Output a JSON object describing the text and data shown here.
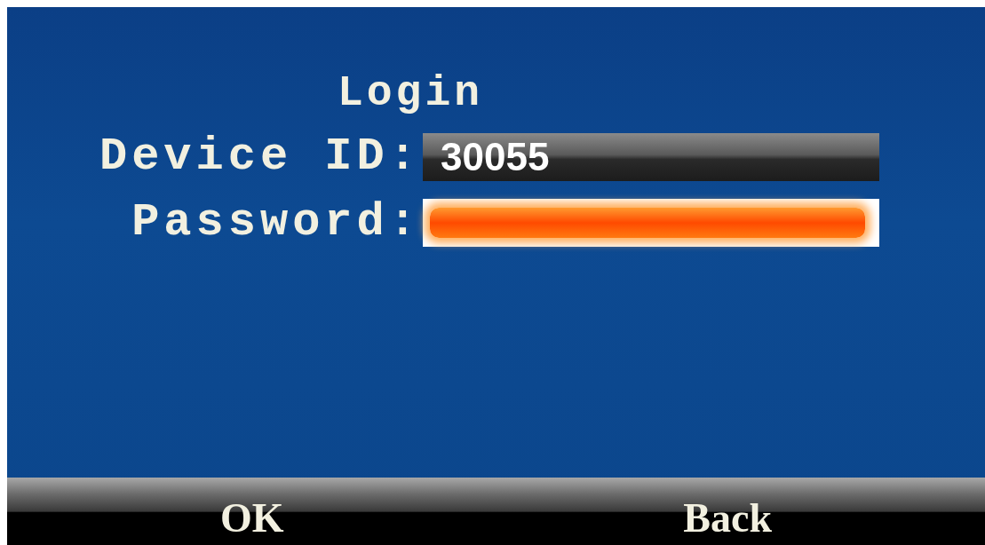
{
  "title": "Login",
  "fields": [
    {
      "label": "Device ID:",
      "value": "30055",
      "selected": false
    },
    {
      "label": "Password:",
      "selected": true
    }
  ],
  "softkeys": [
    "OK",
    "Back"
  ]
}
